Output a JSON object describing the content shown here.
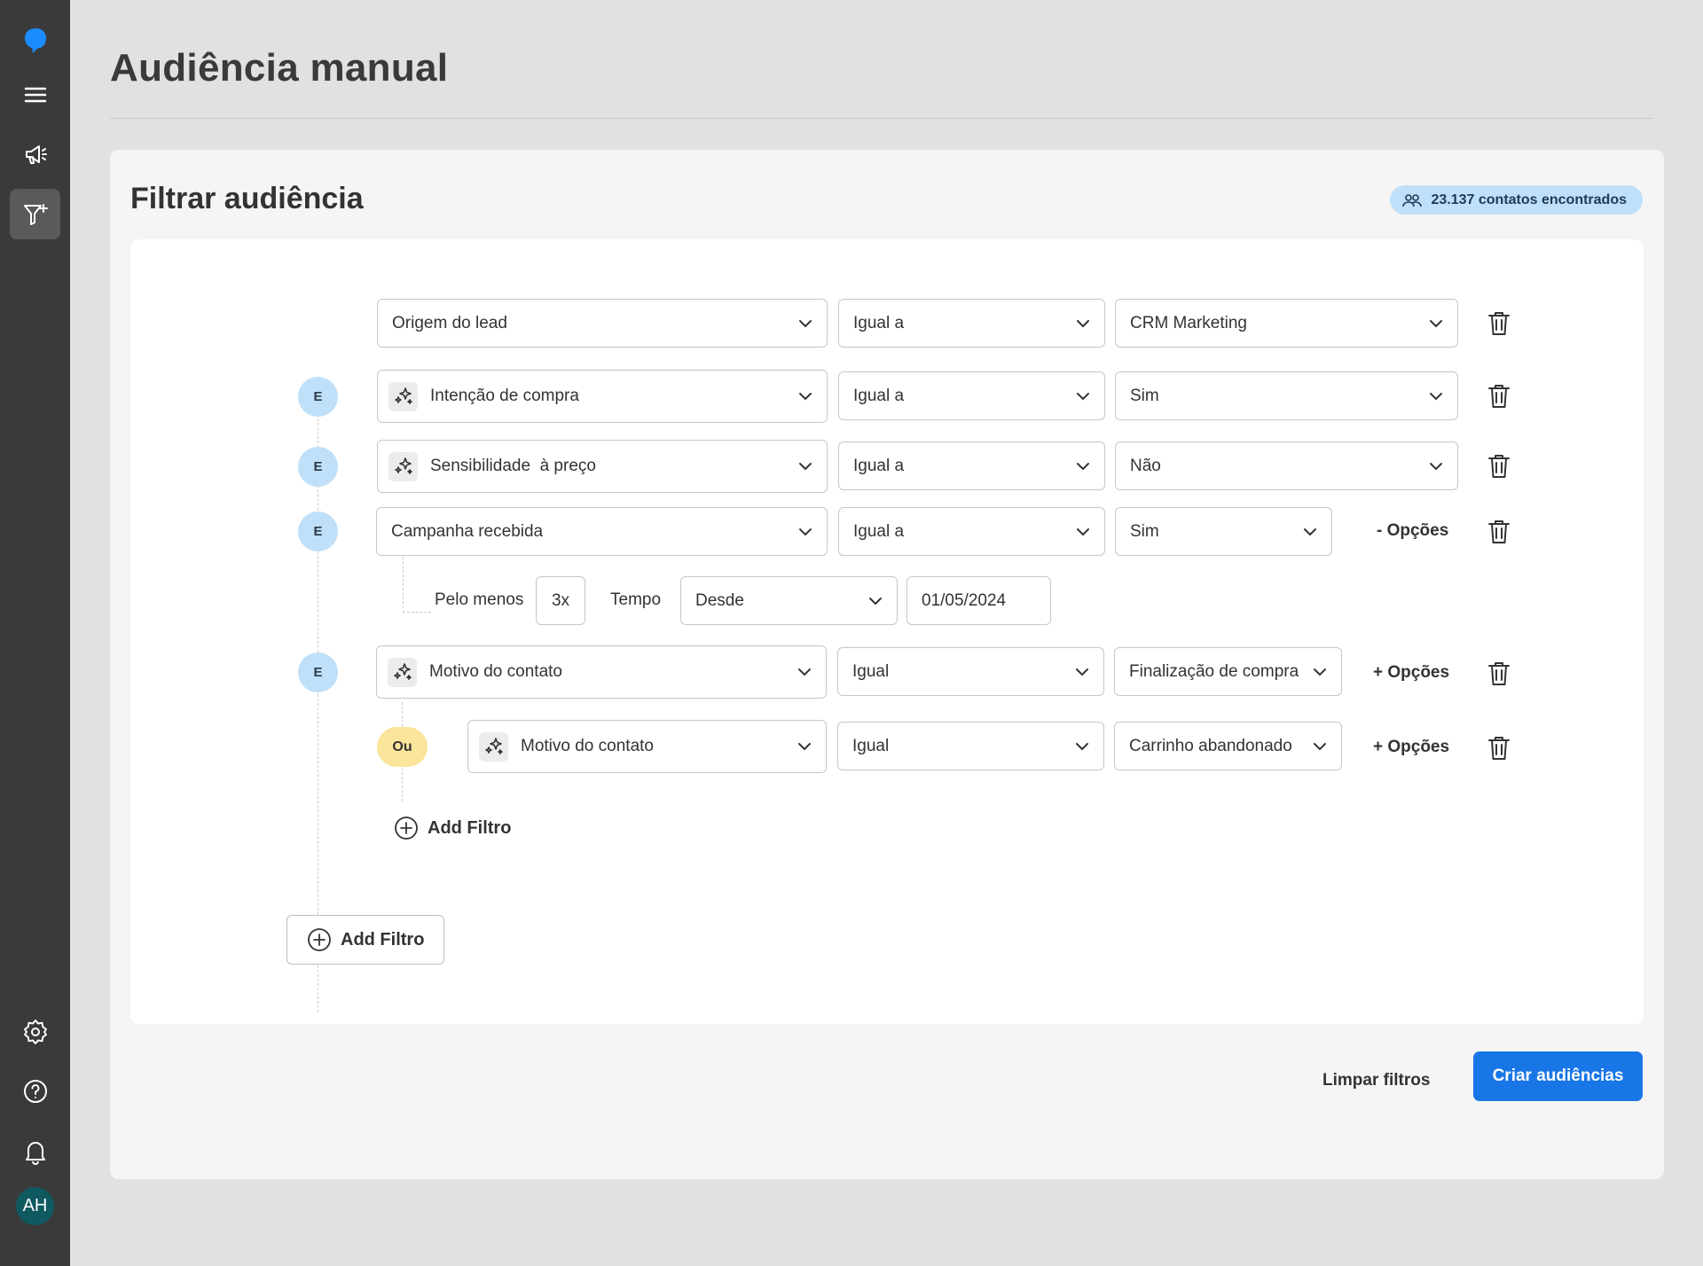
{
  "sidebar": {
    "items": [
      {
        "icon": "chat-logo-icon"
      },
      {
        "icon": "menu-icon"
      },
      {
        "icon": "megaphone-icon"
      },
      {
        "icon": "filter-plus-icon",
        "active": true
      },
      {
        "icon": "gear-icon"
      },
      {
        "icon": "help-icon"
      },
      {
        "icon": "bell-icon"
      }
    ],
    "avatar_initials": "AH",
    "logo_color": "#1a8cff"
  },
  "header": {
    "title": "Audiência manual"
  },
  "panel": {
    "title": "Filtrar audiência",
    "count_label": "23.137 contatos encontrados"
  },
  "filters": [
    {
      "field": "Origem do lead",
      "operator": "Igual a",
      "value": "CRM Marketing",
      "ai": false
    },
    {
      "connector": "E",
      "field": "Intenção de compra",
      "operator": "Igual a",
      "value": "Sim",
      "ai": true
    },
    {
      "connector": "E",
      "field": "Sensibilidade  à preço",
      "operator": "Igual a",
      "value": "Não",
      "ai": true
    },
    {
      "connector": "E",
      "field": "Campanha recebida",
      "operator": "Igual a",
      "value": "Sim",
      "ai": false,
      "options_label": "- Opções",
      "sub": {
        "at_least_label": "Pelo menos",
        "at_least_value": "3x",
        "time_label": "Tempo",
        "time_operator": "Desde",
        "date": "01/05/2024"
      }
    },
    {
      "connector": "E",
      "field": "Motivo do contato",
      "operator": "Igual",
      "value": "Finalização de compra",
      "ai": true,
      "options_label": "+ Opções"
    },
    {
      "connector": "Ou",
      "field": "Motivo do contato",
      "operator": "Igual",
      "value": "Carrinho abandonado",
      "ai": true,
      "options_label": "+ Opções"
    }
  ],
  "group_add_label": "Add Filtro",
  "add_filter_label": "Add Filtro",
  "actions": {
    "clear_label": "Limpar filtros",
    "create_label": "Criar audiências"
  },
  "colors": {
    "accent": "#1976e6",
    "connector_and": "#bfe0f8",
    "connector_or": "#fbe59a"
  }
}
